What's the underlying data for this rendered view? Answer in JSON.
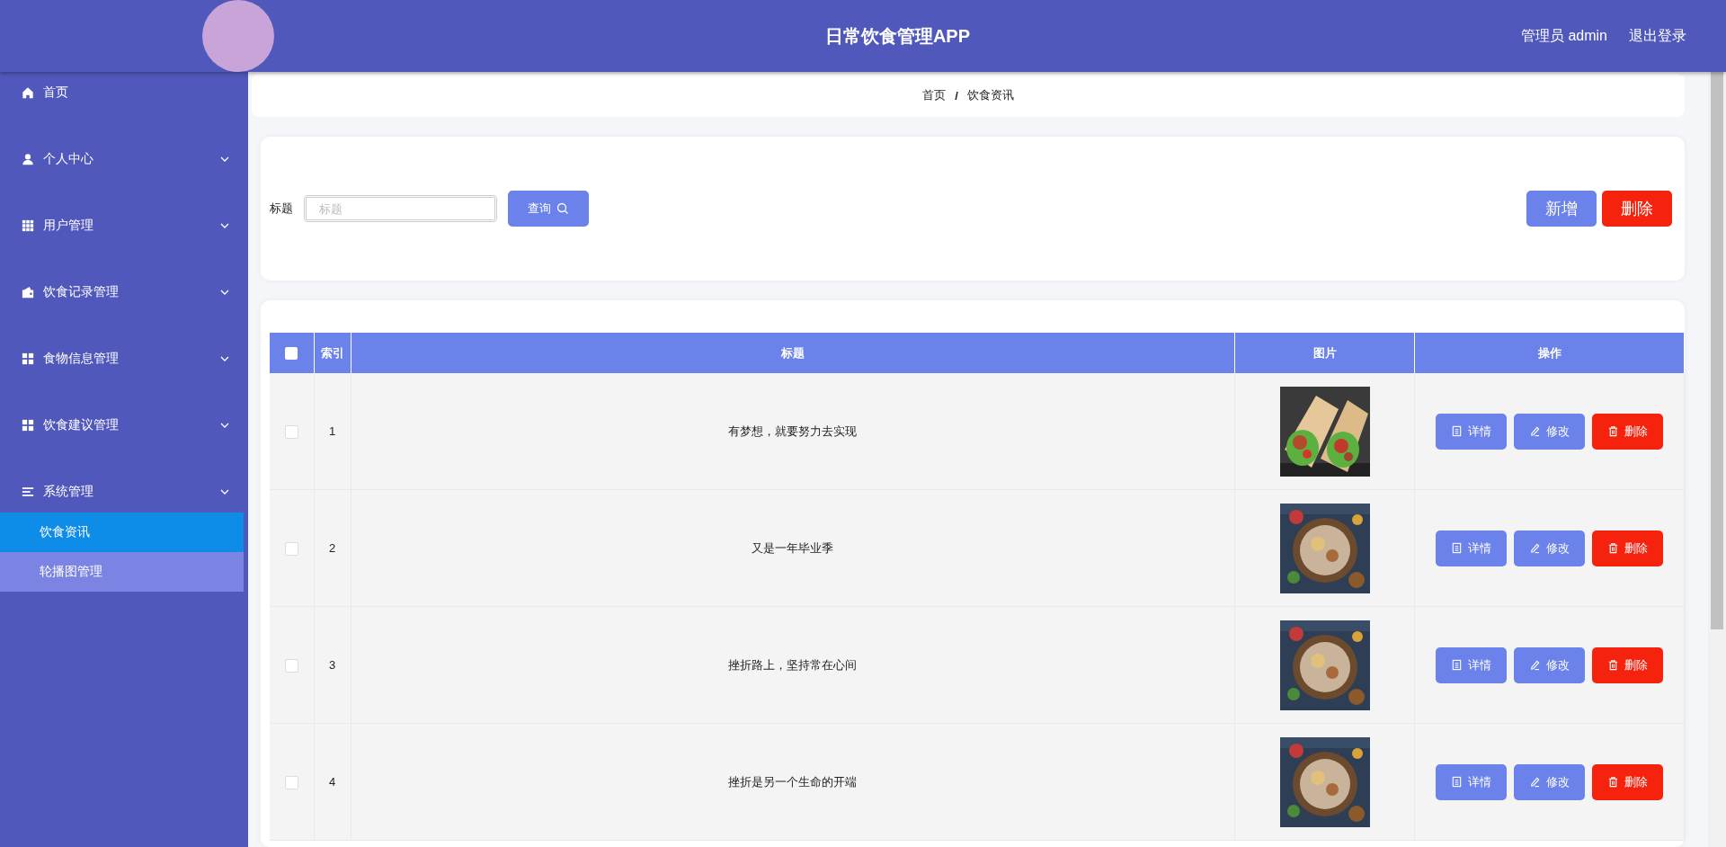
{
  "header": {
    "title": "日常饮食管理APP",
    "user": "管理员 admin",
    "logout": "退出登录"
  },
  "sidebar": {
    "items": [
      {
        "label": "首页"
      },
      {
        "label": "个人中心",
        "expanded": false,
        "has_submenu": true
      },
      {
        "label": "用户管理",
        "expanded": false,
        "has_submenu": true
      },
      {
        "label": "饮食记录管理",
        "expanded": false,
        "has_submenu": true
      },
      {
        "label": "食物信息管理",
        "expanded": false,
        "has_submenu": true
      },
      {
        "label": "饮食建议管理",
        "expanded": false,
        "has_submenu": true
      },
      {
        "label": "系统管理",
        "expanded": true,
        "has_submenu": true,
        "children": [
          {
            "label": "饮食资讯",
            "selected": true
          },
          {
            "label": "轮播图管理",
            "selected": false
          }
        ]
      }
    ]
  },
  "breadcrumb": {
    "items": [
      "首页",
      "饮食资讯"
    ],
    "separator": "/"
  },
  "search": {
    "label": "标题",
    "placeholder": "标题",
    "button": "查询"
  },
  "actions": {
    "add": "新增",
    "delete": "删除"
  },
  "table": {
    "header_checked": false,
    "columns": [
      "索引",
      "标题",
      "图片",
      "操作"
    ],
    "rows": [
      {
        "checked": false,
        "index": "1",
        "title": "有梦想，就要努力去实现",
        "image": {
          "kind": "picture"
        },
        "buttons": [
          "详情",
          "修改",
          "删除"
        ]
      },
      {
        "checked": false,
        "index": "2",
        "title": "又是一年毕业季",
        "image": {
          "kind": "picture"
        },
        "buttons": [
          "详情",
          "修改",
          "删除"
        ]
      },
      {
        "checked": false,
        "index": "3",
        "title": "挫折路上，坚持常在心间",
        "image": {
          "kind": "picture"
        },
        "buttons": [
          "详情",
          "修改",
          "删除"
        ]
      },
      {
        "checked": false,
        "index": "4",
        "title": "挫折是另一个生命的开端",
        "image": {
          "kind": "picture"
        },
        "buttons": [
          "详情",
          "修改",
          "删除"
        ]
      }
    ]
  }
}
